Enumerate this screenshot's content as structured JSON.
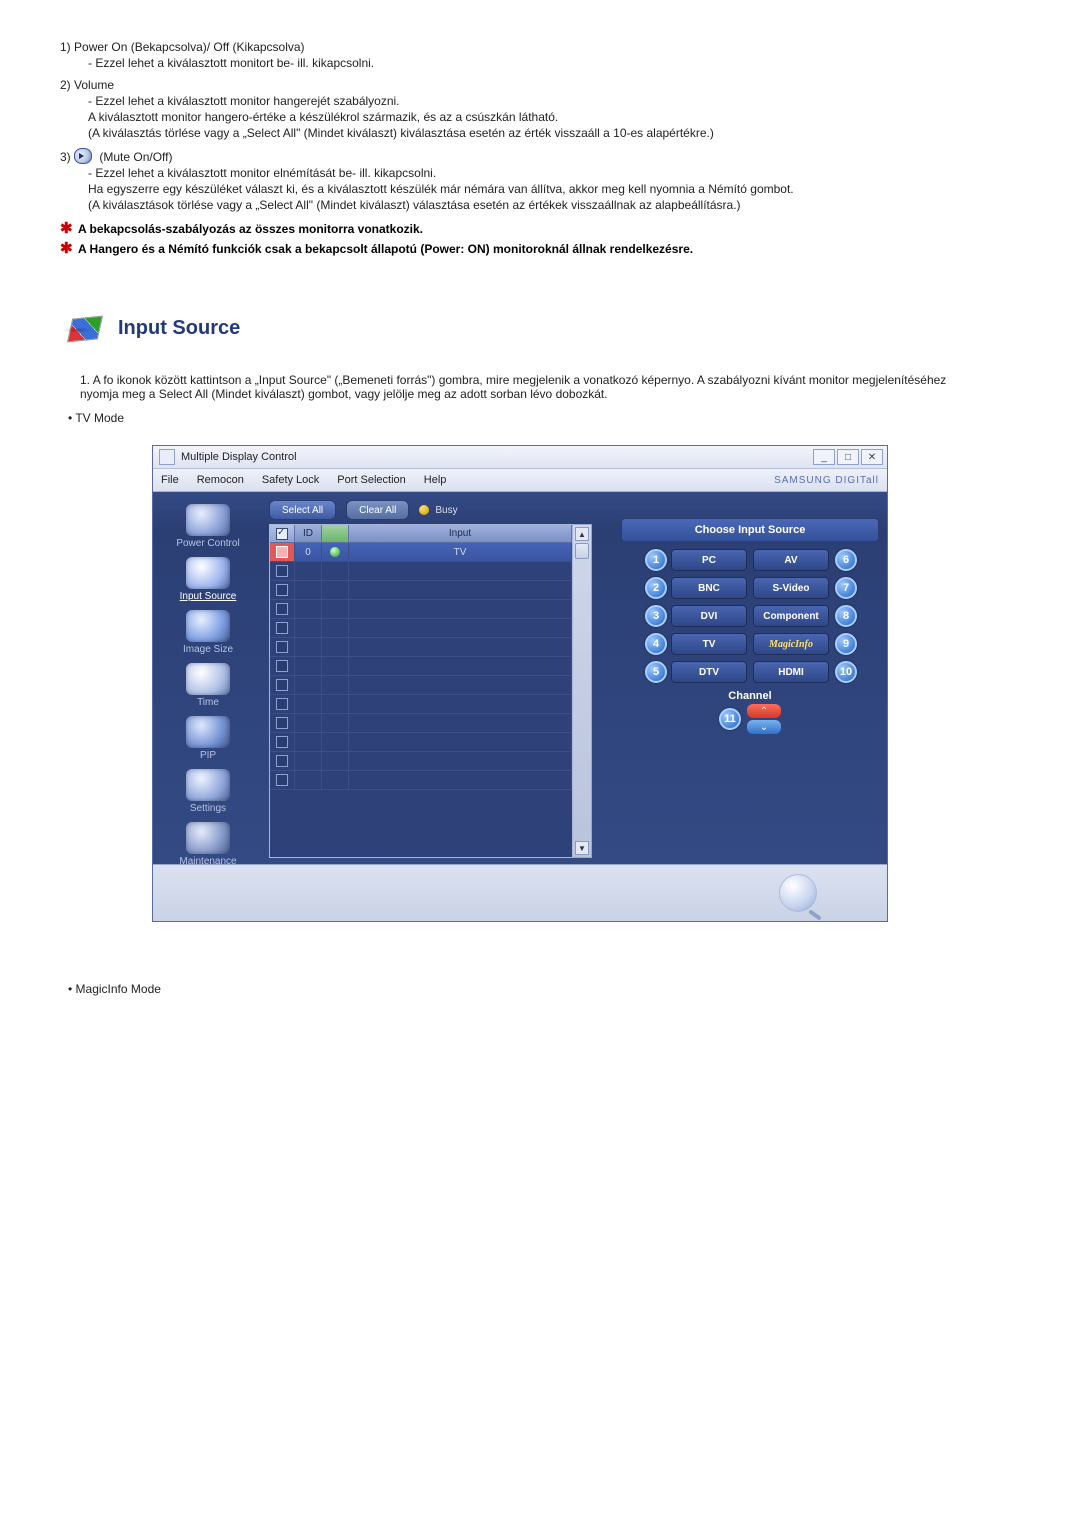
{
  "items": [
    {
      "num": "1)",
      "title": "Power On (Bekapcsolva)/ Off (Kikapcsolva)",
      "lines": [
        "Ezzel lehet a kiválasztott monitort be- ill. kikapcsolni."
      ]
    },
    {
      "num": "2)",
      "title": "Volume",
      "lines": [
        "Ezzel lehet a kiválasztott monitor hangerejét szabályozni.",
        "A kiválasztott monitor hangero-értéke a készülékrol származik, és az a csúszkán látható.",
        "(A kiválasztás törlése vagy a „Select All\" (Mindet kiválaszt) kiválasztása esetén az érték visszaáll a 10-es alapértékre.)"
      ]
    },
    {
      "num": "3)",
      "title": "(Mute On/Off)",
      "hasIcon": true,
      "lines": [
        "Ezzel lehet a kiválasztott monitor elnémítását be- ill. kikapcsolni.",
        "Ha egyszerre egy készüléket választ ki, és a kiválasztott készülék már némára van állítva, akkor meg kell nyomnia a Némító gombot.",
        "(A kiválasztások törlése vagy a „Select All\" (Mindet kiválaszt) választása esetén az értékek visszaállnak az alapbeállításra.)"
      ]
    }
  ],
  "stars": [
    "A bekapcsolás-szabályozás az összes monitorra vonatkozik.",
    "A Hangero és a Némító funkciók csak a bekapcsolt állapotú (Power: ON) monitoroknál állnak rendelkezésre."
  ],
  "section": "Input Source",
  "para1_idx": "1.",
  "para1": "A fo ikonok között kattintson a „Input Source\" („Bemeneti forrás\") gombra, mire megjelenik a vonatkozó képernyo. A szabályozni kívánt monitor megjelenítéséhez nyomja meg a Select All (Mindet kiválaszt) gombot, vagy jelölje meg az adott sorban lévo dobozkát.",
  "bullet_tv": "• TV Mode",
  "bullet_mi": "• MagicInfo Mode",
  "window": {
    "title": "Multiple Display Control",
    "minimize": "_",
    "maximize": "□",
    "close": "✕",
    "menus": [
      "File",
      "Remocon",
      "Safety Lock",
      "Port Selection",
      "Help"
    ],
    "brand": "SAMSUNG DIGITall",
    "selectAll": "Select All",
    "clearAll": "Clear All",
    "busy": "Busy",
    "nav": [
      {
        "cls": "pc",
        "label": "Power Control"
      },
      {
        "cls": "input",
        "label": "Input Source",
        "active": true
      },
      {
        "cls": "img",
        "label": "Image Size"
      },
      {
        "cls": "time",
        "label": "Time"
      },
      {
        "cls": "pip",
        "label": "PIP"
      },
      {
        "cls": "set",
        "label": "Settings"
      },
      {
        "cls": "maint",
        "label": "Maintenance"
      }
    ],
    "grid": {
      "col_id": "ID",
      "col_input": "Input",
      "row0": {
        "id": "0",
        "input": "TV"
      }
    },
    "rp": {
      "header": "Choose Input Source",
      "left": [
        {
          "n": "1",
          "t": "PC"
        },
        {
          "n": "2",
          "t": "BNC"
        },
        {
          "n": "3",
          "t": "DVI"
        },
        {
          "n": "4",
          "t": "TV"
        },
        {
          "n": "5",
          "t": "DTV"
        }
      ],
      "right": [
        {
          "n": "6",
          "t": "AV"
        },
        {
          "n": "7",
          "t": "S-Video"
        },
        {
          "n": "8",
          "t": "Component"
        },
        {
          "n": "9",
          "t": "MagicInfo",
          "magic": true
        },
        {
          "n": "10",
          "t": "HDMI"
        }
      ],
      "channel": "Channel",
      "chBadge": "11",
      "up": "⌃",
      "down": "⌄"
    }
  }
}
